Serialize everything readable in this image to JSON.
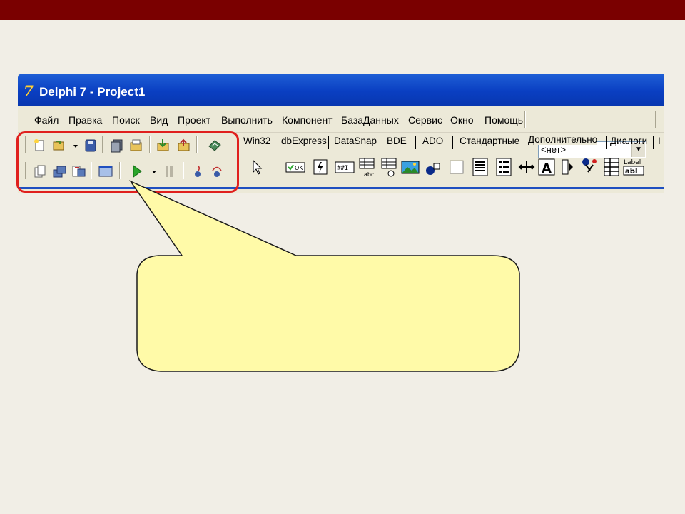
{
  "window": {
    "title": "Delphi 7 - Project1",
    "app_icon": "delphi-7-icon"
  },
  "menu": [
    "Файл",
    "Правка",
    "Поиск",
    "Вид",
    "Проект",
    "Выполнить",
    "Компонент",
    "БазаДанных",
    "Сервис",
    "Окно",
    "Помощь"
  ],
  "combo": {
    "value": "<нет>"
  },
  "palette_tabs": [
    "Win32",
    "dbExpress",
    "DataSnap",
    "BDE",
    "ADO",
    "Стандартные",
    "Дополнительно",
    "Диалоги",
    "I"
  ],
  "active_tab": "Дополнительно",
  "palette_labels": {
    "label1": "Label",
    "label2": "abI",
    "abc": "abc",
    "mask": "##I",
    "ok": "OK"
  },
  "colors": {
    "top_bar": "#7a0000",
    "titlebar": "#0a3fc2",
    "highlight": "#e0201e",
    "callout_fill": "#fffaa8"
  }
}
